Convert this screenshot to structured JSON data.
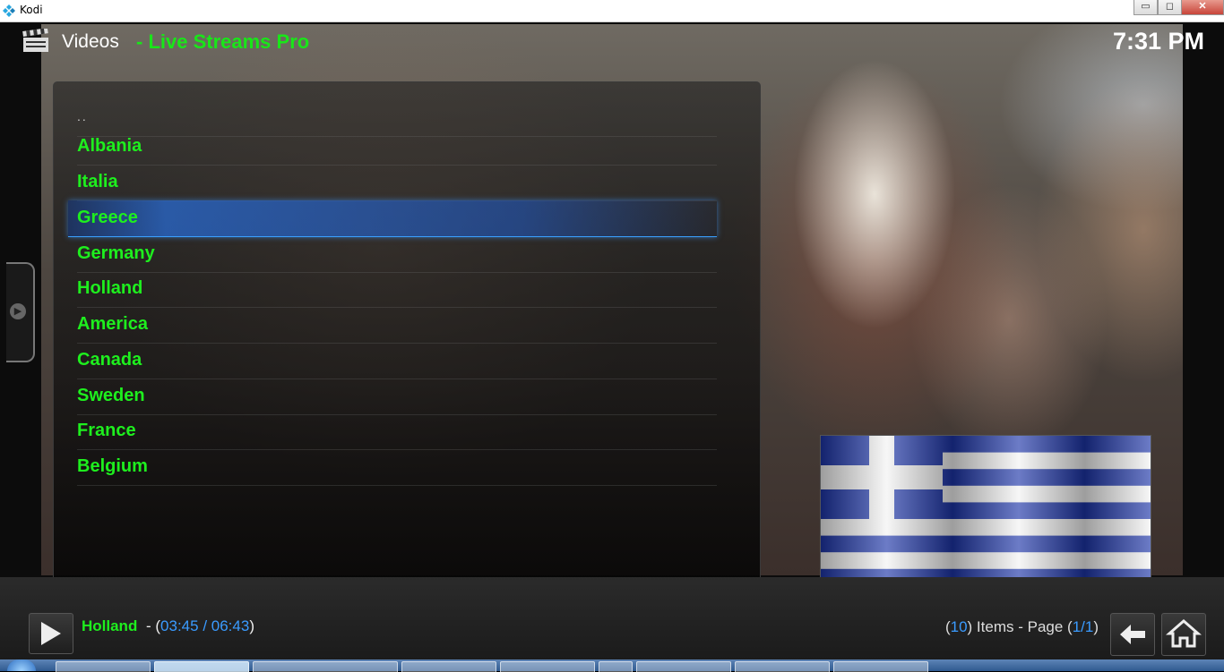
{
  "window": {
    "title": "Kodi",
    "buttons": {
      "minimize": "▭",
      "maximize": "◻",
      "close": "✕"
    }
  },
  "header": {
    "section": "Videos",
    "addon": "- Live Streams Pro",
    "clock": "7:31 PM"
  },
  "list": {
    "parent": "..",
    "items": [
      "Albania",
      "Italia",
      "Greece",
      "Germany",
      "Holland",
      "America",
      "Canada",
      "Sweden",
      "France",
      "Belgium"
    ],
    "focused": "Greece"
  },
  "now_playing": {
    "title": "Holland",
    "separator": "- (",
    "elapsed": "03:45",
    "divider": " / ",
    "duration": "06:43",
    "close": ")"
  },
  "page_info": {
    "open1": "(",
    "count": "10",
    "mid": ") Items - Page (",
    "page": "1/1",
    "close": ")"
  },
  "colors": {
    "accent_green": "#1eef1e",
    "accent_blue": "#3a9bff",
    "flag_blue": "#1d35a8"
  },
  "icons": {
    "app": "kodi-logo-icon",
    "section": "clapperboard-icon",
    "side_tab": "chevron-right-icon",
    "play": "play-icon",
    "back": "back-arrow-icon",
    "home": "home-icon"
  }
}
